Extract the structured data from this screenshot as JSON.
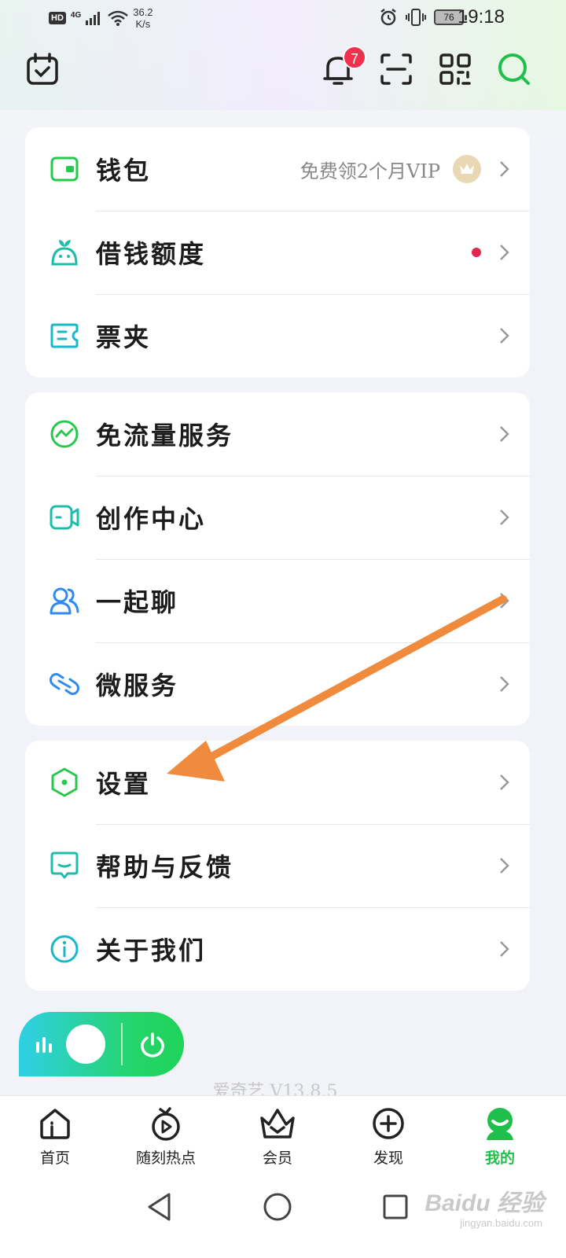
{
  "status_bar": {
    "hd": "HD",
    "network": "4G",
    "speed_value": "36.2",
    "speed_unit": "K/s",
    "battery": "76",
    "time": "19:18"
  },
  "header": {
    "icons": [
      "calendar-check-icon",
      "bell-icon",
      "scan-icon",
      "qr-code-icon",
      "search-icon"
    ],
    "notification_count": "7",
    "accent_color": "#1fbf4c"
  },
  "groups": [
    {
      "items": [
        {
          "label": "钱包",
          "icon": "wallet-icon",
          "extra_text": "免费领2个月VIP",
          "has_vip_badge": true
        },
        {
          "label": "借钱额度",
          "icon": "sprout-icon",
          "has_red_dot": true
        },
        {
          "label": "票夹",
          "icon": "ticket-icon"
        }
      ]
    },
    {
      "items": [
        {
          "label": "免流量服务",
          "icon": "traffic-free-icon"
        },
        {
          "label": "创作中心",
          "icon": "video-camera-icon"
        },
        {
          "label": "一起聊",
          "icon": "users-icon"
        },
        {
          "label": "微服务",
          "icon": "link-icon"
        }
      ]
    },
    {
      "items": [
        {
          "label": "设置",
          "icon": "settings-hexagon-icon"
        },
        {
          "label": "帮助与反馈",
          "icon": "feedback-icon"
        },
        {
          "label": "关于我们",
          "icon": "info-icon"
        }
      ]
    }
  ],
  "version": "爱奇艺 V13.8.5",
  "bottom_nav": [
    {
      "label": "首页",
      "icon": "home-icon",
      "active": false
    },
    {
      "label": "随刻热点",
      "icon": "play-circle-icon",
      "active": false
    },
    {
      "label": "会员",
      "icon": "vip-basket-icon",
      "active": false
    },
    {
      "label": "发现",
      "icon": "plus-circle-icon",
      "active": false
    },
    {
      "label": "我的",
      "icon": "profile-icon",
      "active": true
    }
  ],
  "system_nav": [
    "back-icon",
    "home-circle-icon",
    "recent-apps-icon"
  ],
  "watermark": {
    "text": "Baidu 经验",
    "sub": "jingyan.baidu.com"
  }
}
